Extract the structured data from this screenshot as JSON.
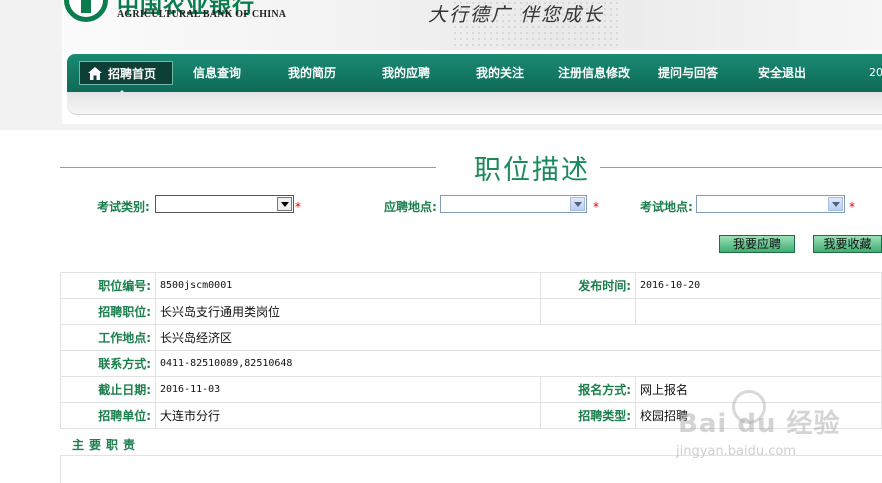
{
  "header": {
    "logo_cn": "中国农业银行",
    "logo_en": "AGRICULTURAL BANK OF CHINA",
    "slogan": "大行德广  伴您成长"
  },
  "nav": {
    "items": [
      {
        "label": "招聘首页",
        "icon": "home-icon",
        "active": true
      },
      {
        "label": "信息查询"
      },
      {
        "label": "我的简历"
      },
      {
        "label": "我的应聘"
      },
      {
        "label": "我的关注"
      },
      {
        "label": "注册信息修改"
      },
      {
        "label": "提问与回答"
      },
      {
        "label": "安全退出"
      }
    ],
    "date_fragment": "20"
  },
  "page_title": "职位描述",
  "form": {
    "exam_type_label": "考试类别:",
    "exam_type_value": "",
    "apply_location_label": "应聘地点:",
    "apply_location_value": "",
    "exam_location_label": "考试地点:",
    "exam_location_value": "",
    "required_mark": "*",
    "apply_button": "我要应聘",
    "favorite_button": "我要收藏"
  },
  "detail": {
    "job_id_label": "职位编号:",
    "job_id": "8500jscm0001",
    "publish_time_label": "发布时间:",
    "publish_time": "2016-10-20",
    "position_label": "招聘职位:",
    "position": "长兴岛支行通用类岗位",
    "work_location_label": "工作地点:",
    "work_location": "长兴岛经济区",
    "contact_label": "联系方式:",
    "contact": "0411-82510089,82510648",
    "deadline_label": "截止日期:",
    "deadline": "2016-11-03",
    "signup_method_label": "报名方式:",
    "signup_method": "网上报名",
    "unit_label": "招聘单位:",
    "unit": "大连市分行",
    "recruit_type_label": "招聘类型:",
    "recruit_type": "校园招聘",
    "duties_label": "主要职责"
  },
  "watermark": {
    "text": "Bai du 经验",
    "sub": "jingyan.baidu.com"
  },
  "colors": {
    "brand_green": "#0b7c4d",
    "nav_green": "#137a64",
    "label_green": "#1a7f4c",
    "required_red": "#e00000"
  }
}
